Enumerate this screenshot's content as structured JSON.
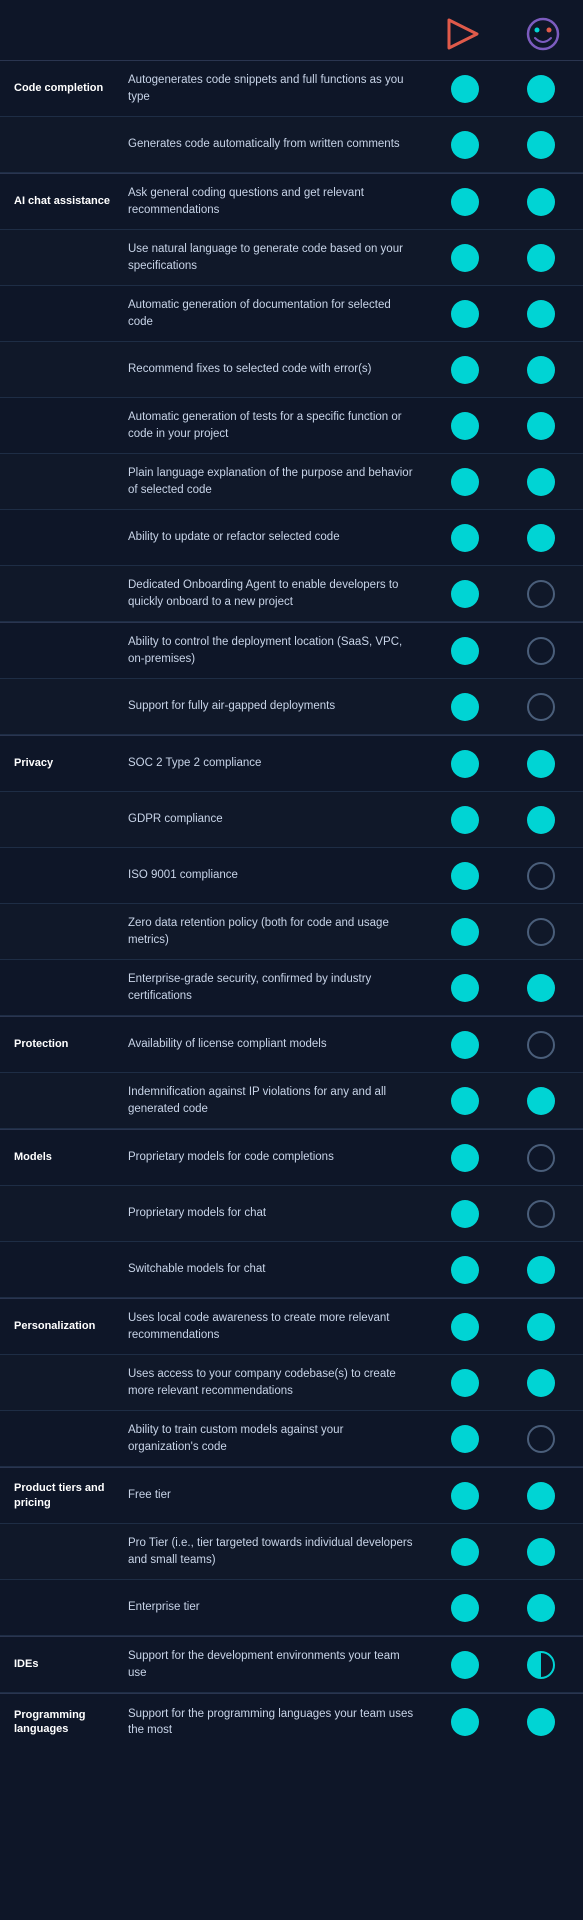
{
  "header": {
    "col1_label": "",
    "col2_label": "",
    "logo1": {
      "name": "codium-logo",
      "symbol": "▷",
      "color": "#e05a4a"
    },
    "logo2": {
      "name": "tabnine-logo",
      "symbol": "◡",
      "color": "#7c5cbf"
    }
  },
  "sections": [
    {
      "category": "Code completion",
      "features": [
        {
          "text": "Autogenerates code snippets and full functions as you type",
          "col1": "filled",
          "col2": "filled"
        },
        {
          "text": "Generates code automatically from written comments",
          "col1": "filled",
          "col2": "filled"
        }
      ]
    },
    {
      "category": "AI chat assistance",
      "features": [
        {
          "text": "Ask general coding questions and get relevant recommendations",
          "col1": "filled",
          "col2": "filled"
        },
        {
          "text": "Use natural language to generate code based on your specifications",
          "col1": "filled",
          "col2": "filled"
        },
        {
          "text": "Automatic generation of documentation for selected code",
          "col1": "filled",
          "col2": "filled"
        },
        {
          "text": "Recommend fixes to selected code with error(s)",
          "col1": "filled",
          "col2": "filled"
        },
        {
          "text": "Automatic generation of tests for a specific function or code in your project",
          "col1": "filled",
          "col2": "filled"
        },
        {
          "text": "Plain language explanation of the purpose and behavior of selected code",
          "col1": "filled",
          "col2": "filled"
        },
        {
          "text": "Ability to update or refactor selected code",
          "col1": "filled",
          "col2": "filled"
        },
        {
          "text": "Dedicated Onboarding Agent to enable developers to quickly onboard to a new project",
          "col1": "filled",
          "col2": "empty"
        }
      ]
    },
    {
      "category": "",
      "features": [
        {
          "text": "Ability to control the deployment location (SaaS, VPC, on-premises)",
          "col1": "filled",
          "col2": "empty"
        },
        {
          "text": "Support for fully air-gapped deployments",
          "col1": "filled",
          "col2": "empty"
        }
      ]
    },
    {
      "category": "Privacy",
      "features": [
        {
          "text": "SOC 2 Type 2 compliance",
          "col1": "filled",
          "col2": "filled"
        },
        {
          "text": "GDPR compliance",
          "col1": "filled",
          "col2": "filled"
        },
        {
          "text": "ISO 9001 compliance",
          "col1": "filled",
          "col2": "empty"
        },
        {
          "text": "Zero data retention policy (both for code and usage metrics)",
          "col1": "filled",
          "col2": "empty"
        },
        {
          "text": "Enterprise-grade security, confirmed by industry certifications",
          "col1": "filled",
          "col2": "filled"
        }
      ]
    },
    {
      "category": "Protection",
      "features": [
        {
          "text": "Availability of license compliant models",
          "col1": "filled",
          "col2": "empty"
        },
        {
          "text": "Indemnification against IP violations for any and all generated code",
          "col1": "filled",
          "col2": "filled"
        }
      ]
    },
    {
      "category": "Models",
      "features": [
        {
          "text": "Proprietary models for code completions",
          "col1": "filled",
          "col2": "empty"
        },
        {
          "text": "Proprietary models for chat",
          "col1": "filled",
          "col2": "empty"
        },
        {
          "text": "Switchable models for chat",
          "col1": "filled",
          "col2": "filled"
        }
      ]
    },
    {
      "category": "Personalization",
      "features": [
        {
          "text": "Uses local code awareness to create more relevant recommendations",
          "col1": "filled",
          "col2": "filled"
        },
        {
          "text": "Uses access to your company codebase(s) to create more relevant recommendations",
          "col1": "filled",
          "col2": "filled"
        },
        {
          "text": "Ability to train custom models against your organization's code",
          "col1": "filled",
          "col2": "empty"
        }
      ]
    },
    {
      "category": "Product tiers and pricing",
      "features": [
        {
          "text": "Free tier",
          "col1": "filled",
          "col2": "filled"
        },
        {
          "text": "Pro Tier (i.e., tier targeted towards individual developers and small teams)",
          "col1": "filled",
          "col2": "filled"
        },
        {
          "text": "Enterprise tier",
          "col1": "filled",
          "col2": "filled"
        }
      ]
    },
    {
      "category": "IDEs",
      "features": [
        {
          "text": "Support for the development environments your team use",
          "col1": "filled",
          "col2": "half"
        }
      ]
    },
    {
      "category": "Programming languages",
      "features": [
        {
          "text": "Support for the programming languages your team uses the most",
          "col1": "filled",
          "col2": "filled"
        }
      ]
    }
  ]
}
